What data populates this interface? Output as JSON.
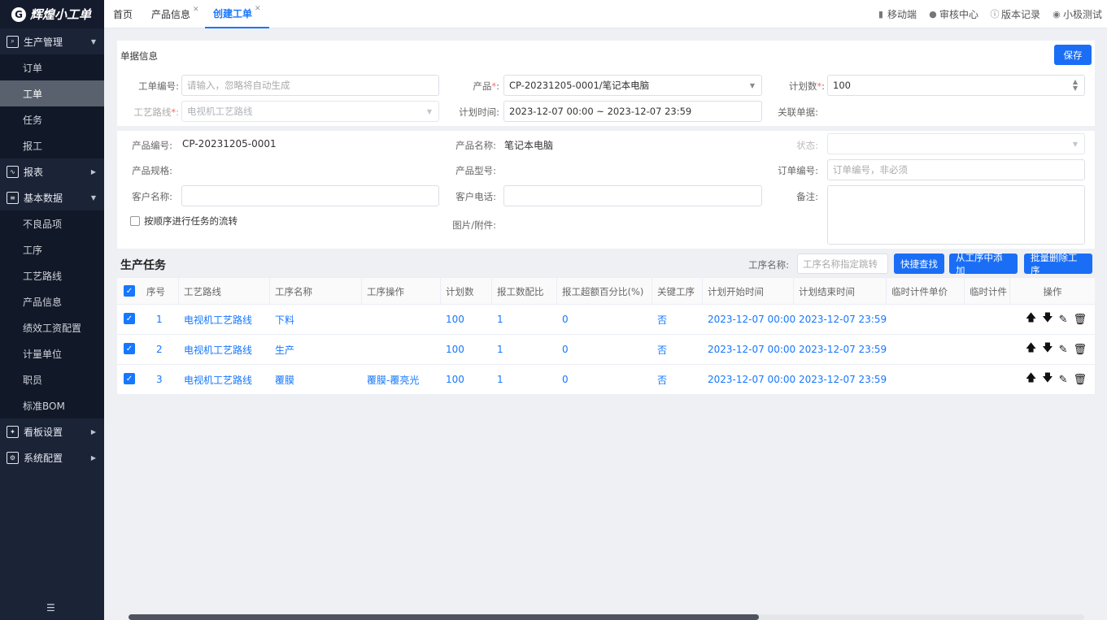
{
  "app": {
    "logo_mark": "G",
    "name": "辉煌小工单"
  },
  "sidebar": {
    "groups": [
      {
        "label": "生产管理",
        "icon": "search-doc-icon",
        "expanded": true,
        "items": [
          {
            "label": "订单"
          },
          {
            "label": "工单",
            "active": true
          },
          {
            "label": "任务"
          },
          {
            "label": "报工"
          }
        ]
      },
      {
        "label": "报表",
        "icon": "chart-icon",
        "expanded": false,
        "items": []
      },
      {
        "label": "基本数据",
        "icon": "list-doc-icon",
        "expanded": true,
        "items": [
          {
            "label": "不良品项"
          },
          {
            "label": "工序"
          },
          {
            "label": "工艺路线"
          },
          {
            "label": "产品信息"
          },
          {
            "label": "绩效工资配置"
          },
          {
            "label": "计量单位"
          },
          {
            "label": "职员"
          },
          {
            "label": "标准BOM"
          }
        ]
      },
      {
        "label": "看板设置",
        "icon": "dashboard-icon",
        "expanded": false,
        "items": []
      },
      {
        "label": "系统配置",
        "icon": "settings-icon",
        "expanded": false,
        "items": []
      }
    ],
    "collapse_glyph": "☰"
  },
  "tabs": [
    {
      "label": "首页",
      "closable": false
    },
    {
      "label": "产品信息",
      "closable": true
    },
    {
      "label": "创建工单",
      "closable": true,
      "active": true
    }
  ],
  "top_right": [
    {
      "label": "移动端",
      "icon": "mobile-icon"
    },
    {
      "label": "审核中心",
      "icon": "user-icon"
    },
    {
      "label": "版本记录",
      "icon": "info-icon"
    },
    {
      "label": "小极测试",
      "icon": "avatar-icon"
    }
  ],
  "form": {
    "section_title": "单据信息",
    "save_label": "保存",
    "order_no": {
      "label": "工单编号:",
      "placeholder": "请输入，忽略将自动生成"
    },
    "product": {
      "label": "产品",
      "value": "CP-20231205-0001/笔记本电脑"
    },
    "plan_qty": {
      "label": "计划数",
      "value": "100"
    },
    "route": {
      "label": "工艺路线",
      "value": "电视机工艺路线"
    },
    "plan_time": {
      "label": "计划时间:",
      "value": "2023-12-07 00:00 ~ 2023-12-07 23:59"
    },
    "related_doc": {
      "label": "关联单据:"
    }
  },
  "product_info": {
    "code": {
      "label": "产品编号:",
      "value": "CP-20231205-0001"
    },
    "name": {
      "label": "产品名称:",
      "value": "笔记本电脑"
    },
    "status": {
      "label": "状态:"
    },
    "spec": {
      "label": "产品规格:"
    },
    "model": {
      "label": "产品型号:"
    },
    "order_ref": {
      "label": "订单编号:",
      "placeholder": "订单编号，非必须"
    },
    "customer": {
      "label": "客户名称:"
    },
    "phone": {
      "label": "客户电话:"
    },
    "remark": {
      "label": "备注:"
    },
    "sequential_check": "按顺序进行任务的流转",
    "attachments": {
      "label": "图片/附件:"
    }
  },
  "tasks": {
    "title": "生产任务",
    "process_name_label": "工序名称:",
    "process_name_placeholder": "工序名称指定跳转",
    "quick_find": "快捷查找",
    "add_from_process": "从工序中添加",
    "batch_delete": "批量删除工序",
    "columns": [
      "序号",
      "工艺路线",
      "工序名称",
      "工序操作",
      "计划数",
      "报工数配比",
      "报工超额百分比(%)",
      "关键工序",
      "计划开始时间",
      "计划结束时间",
      "临时计件单价",
      "临时计件",
      "操作"
    ],
    "rows": [
      {
        "seq": "1",
        "route": "电视机工艺路线",
        "process": "下料",
        "op": "",
        "qty": "100",
        "ratio": "1",
        "over": "0",
        "key": "否",
        "start": "2023-12-07 00:00",
        "end": "2023-12-07 23:59"
      },
      {
        "seq": "2",
        "route": "电视机工艺路线",
        "process": "生产",
        "op": "",
        "qty": "100",
        "ratio": "1",
        "over": "0",
        "key": "否",
        "start": "2023-12-07 00:00",
        "end": "2023-12-07 23:59"
      },
      {
        "seq": "3",
        "route": "电视机工艺路线",
        "process": "覆膜",
        "op": "覆膜-覆亮光",
        "qty": "100",
        "ratio": "1",
        "over": "0",
        "key": "否",
        "start": "2023-12-07 00:00",
        "end": "2023-12-07 23:59"
      }
    ]
  }
}
